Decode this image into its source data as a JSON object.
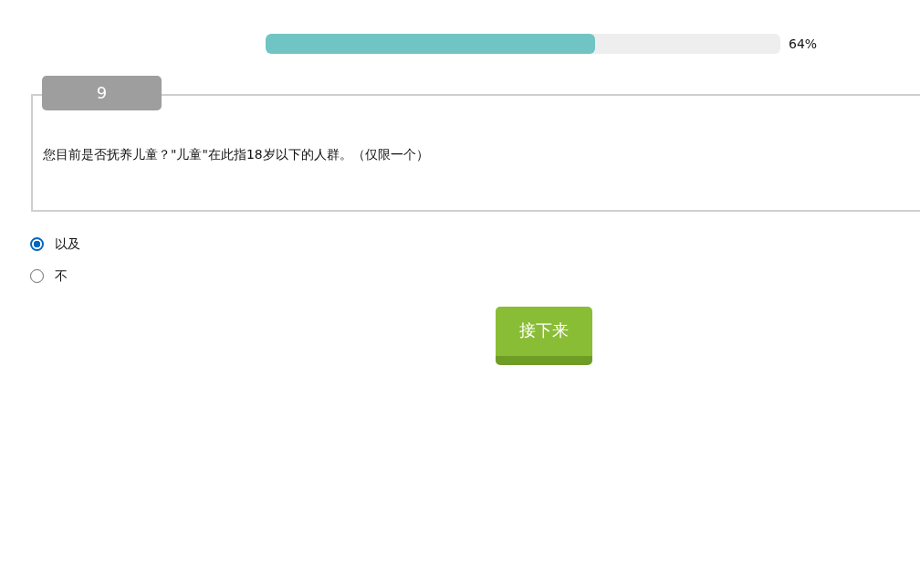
{
  "progress": {
    "level": 0.64,
    "reading": "64%"
  },
  "question": {
    "number": "9",
    "text": "您目前是否抚养儿童？\"儿童\"在此指18岁以下的人群。（仅限一个）"
  },
  "options": [
    {
      "label": "以及",
      "selected": true
    },
    {
      "label": "不",
      "selected": false
    }
  ],
  "next_button": {
    "label": "接下来"
  }
}
